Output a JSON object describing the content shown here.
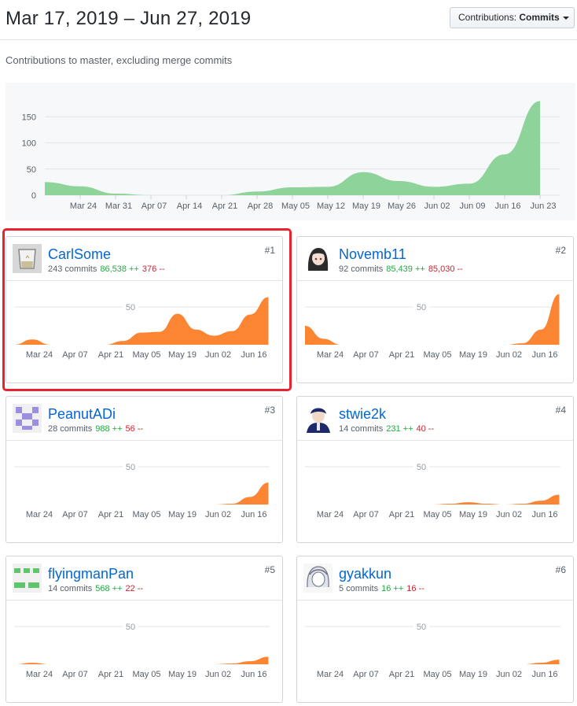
{
  "header": {
    "date_range": "Mar 17, 2019 – Jun 27, 2019",
    "dropdown_prefix": "Contributions:",
    "dropdown_value": "Commits"
  },
  "description": "Contributions to master, excluding merge commits",
  "colors": {
    "main_area": "#8ed39a",
    "contributor_area": "#fb8532",
    "link": "#0366d6",
    "additions": "#28a745",
    "deletions": "#cb2431",
    "highlight": "#e8232f"
  },
  "chart_data": [
    {
      "type": "area",
      "title": "",
      "x_ticks": [
        "Mar 24",
        "Mar 31",
        "Apr 07",
        "Apr 14",
        "Apr 21",
        "Apr 28",
        "May 05",
        "May 12",
        "May 19",
        "May 26",
        "Jun 02",
        "Jun 09",
        "Jun 16",
        "Jun 23"
      ],
      "y_ticks": [
        0,
        50,
        100,
        150
      ],
      "ylim": [
        0,
        185
      ],
      "grid": true,
      "series": [
        {
          "x": [
            "Mar 17",
            "Mar 24",
            "Mar 31",
            "Apr 07",
            "Apr 14",
            "Apr 21",
            "Apr 28",
            "May 05",
            "May 12",
            "May 19",
            "May 26",
            "Jun 02",
            "Jun 09",
            "Jun 16",
            "Jun 23"
          ],
          "values": [
            25,
            17,
            3,
            0,
            0,
            0,
            7,
            15,
            16,
            44,
            27,
            16,
            22,
            78,
            180
          ]
        }
      ]
    },
    {
      "type": "area",
      "title": "CarlSome",
      "x_ticks": [
        "Mar 24",
        "Apr 07",
        "Apr 21",
        "May 05",
        "May 19",
        "Jun 02",
        "Jun 16"
      ],
      "y_ticks": [
        50
      ],
      "ylim": [
        0,
        75
      ],
      "series": [
        {
          "x": [
            "Mar 17",
            "Mar 24",
            "Mar 31",
            "Apr 07",
            "Apr 14",
            "Apr 21",
            "Apr 28",
            "May 05",
            "May 12",
            "May 19",
            "May 26",
            "Jun 02",
            "Jun 09",
            "Jun 16",
            "Jun 23"
          ],
          "values": [
            0,
            7,
            0,
            0,
            0,
            0,
            5,
            16,
            17,
            41,
            20,
            12,
            18,
            40,
            63
          ]
        }
      ]
    },
    {
      "type": "area",
      "title": "Novemb11",
      "x_ticks": [
        "Mar 24",
        "Apr 07",
        "Apr 21",
        "May 05",
        "May 19",
        "Jun 02",
        "Jun 16"
      ],
      "y_ticks": [
        50
      ],
      "ylim": [
        0,
        75
      ],
      "series": [
        {
          "x": [
            "Mar 17",
            "Mar 24",
            "Mar 31",
            "Apr 07",
            "Apr 14",
            "Apr 21",
            "Apr 28",
            "May 05",
            "May 12",
            "May 19",
            "May 26",
            "Jun 02",
            "Jun 09",
            "Jun 16",
            "Jun 23"
          ],
          "values": [
            25,
            8,
            0,
            0,
            0,
            0,
            0,
            0,
            0,
            0,
            0,
            0,
            2,
            20,
            67
          ]
        }
      ]
    },
    {
      "type": "area",
      "title": "PeanutADi",
      "x_ticks": [
        "Mar 24",
        "Apr 07",
        "Apr 21",
        "May 05",
        "May 19",
        "Jun 02",
        "Jun 16"
      ],
      "y_ticks": [
        50
      ],
      "ylim": [
        0,
        75
      ],
      "series": [
        {
          "x": [
            "Mar 17",
            "Mar 24",
            "Mar 31",
            "Apr 07",
            "Apr 14",
            "Apr 21",
            "Apr 28",
            "May 05",
            "May 12",
            "May 19",
            "May 26",
            "Jun 02",
            "Jun 09",
            "Jun 16",
            "Jun 23"
          ],
          "values": [
            0,
            0,
            0,
            0,
            0,
            0,
            0,
            0,
            0,
            0,
            0,
            0,
            1,
            10,
            29
          ]
        }
      ]
    },
    {
      "type": "area",
      "title": "stwie2k",
      "x_ticks": [
        "Mar 24",
        "Apr 07",
        "Apr 21",
        "May 05",
        "May 19",
        "Jun 02",
        "Jun 16"
      ],
      "y_ticks": [
        50
      ],
      "ylim": [
        0,
        75
      ],
      "series": [
        {
          "x": [
            "Mar 17",
            "Mar 24",
            "Mar 31",
            "Apr 07",
            "Apr 14",
            "Apr 21",
            "Apr 28",
            "May 05",
            "May 12",
            "May 19",
            "May 26",
            "Jun 02",
            "Jun 09",
            "Jun 16",
            "Jun 23"
          ],
          "values": [
            0,
            0,
            0,
            0,
            0,
            0,
            0,
            0,
            1,
            3,
            1,
            0,
            1,
            5,
            13
          ]
        }
      ]
    },
    {
      "type": "area",
      "title": "flyingmanPan",
      "x_ticks": [
        "Mar 24",
        "Apr 07",
        "Apr 21",
        "May 05",
        "May 19",
        "Jun 02",
        "Jun 16"
      ],
      "y_ticks": [
        50
      ],
      "ylim": [
        0,
        75
      ],
      "series": [
        {
          "x": [
            "Mar 17",
            "Mar 24",
            "Mar 31",
            "Apr 07",
            "Apr 14",
            "Apr 21",
            "Apr 28",
            "May 05",
            "May 12",
            "May 19",
            "May 26",
            "Jun 02",
            "Jun 09",
            "Jun 16",
            "Jun 23"
          ],
          "values": [
            0,
            2,
            0,
            0,
            0,
            0,
            0,
            0,
            0,
            0,
            0,
            0,
            1,
            4,
            10
          ]
        }
      ]
    },
    {
      "type": "area",
      "title": "gyakkun",
      "x_ticks": [
        "Mar 24",
        "Apr 07",
        "Apr 21",
        "May 05",
        "May 19",
        "Jun 02",
        "Jun 16"
      ],
      "y_ticks": [
        50
      ],
      "ylim": [
        0,
        75
      ],
      "series": [
        {
          "x": [
            "Mar 17",
            "Mar 24",
            "Mar 31",
            "Apr 07",
            "Apr 14",
            "Apr 21",
            "Apr 28",
            "May 05",
            "May 12",
            "May 19",
            "May 26",
            "Jun 02",
            "Jun 09",
            "Jun 16",
            "Jun 23"
          ],
          "values": [
            0,
            0,
            0,
            0,
            0,
            0,
            0,
            0,
            0,
            0,
            0,
            0,
            0,
            2,
            6
          ]
        }
      ]
    }
  ],
  "contributors": [
    {
      "name": "CarlSome",
      "commits": "243 commits",
      "additions": "86,538 ++",
      "deletions": "376 --",
      "rank": "#1",
      "avatar": "glass-icon"
    },
    {
      "name": "Novemb11",
      "commits": "92 commits",
      "additions": "85,439 ++",
      "deletions": "85,030 --",
      "rank": "#2",
      "avatar": "anime-girl-icon"
    },
    {
      "name": "PeanutADi",
      "commits": "28 commits",
      "additions": "988 ++",
      "deletions": "56 --",
      "rank": "#3",
      "avatar": "identicon-purple"
    },
    {
      "name": "stwie2k",
      "commits": "14 commits",
      "additions": "231 ++",
      "deletions": "40 --",
      "rank": "#4",
      "avatar": "anime-boy-icon"
    },
    {
      "name": "flyingmanPan",
      "commits": "14 commits",
      "additions": "568 ++",
      "deletions": "22 --",
      "rank": "#5",
      "avatar": "identicon-green"
    },
    {
      "name": "gyakkun",
      "commits": "5 commits",
      "additions": "16 ++",
      "deletions": "16 --",
      "rank": "#6",
      "avatar": "sketch-portrait-icon"
    }
  ]
}
